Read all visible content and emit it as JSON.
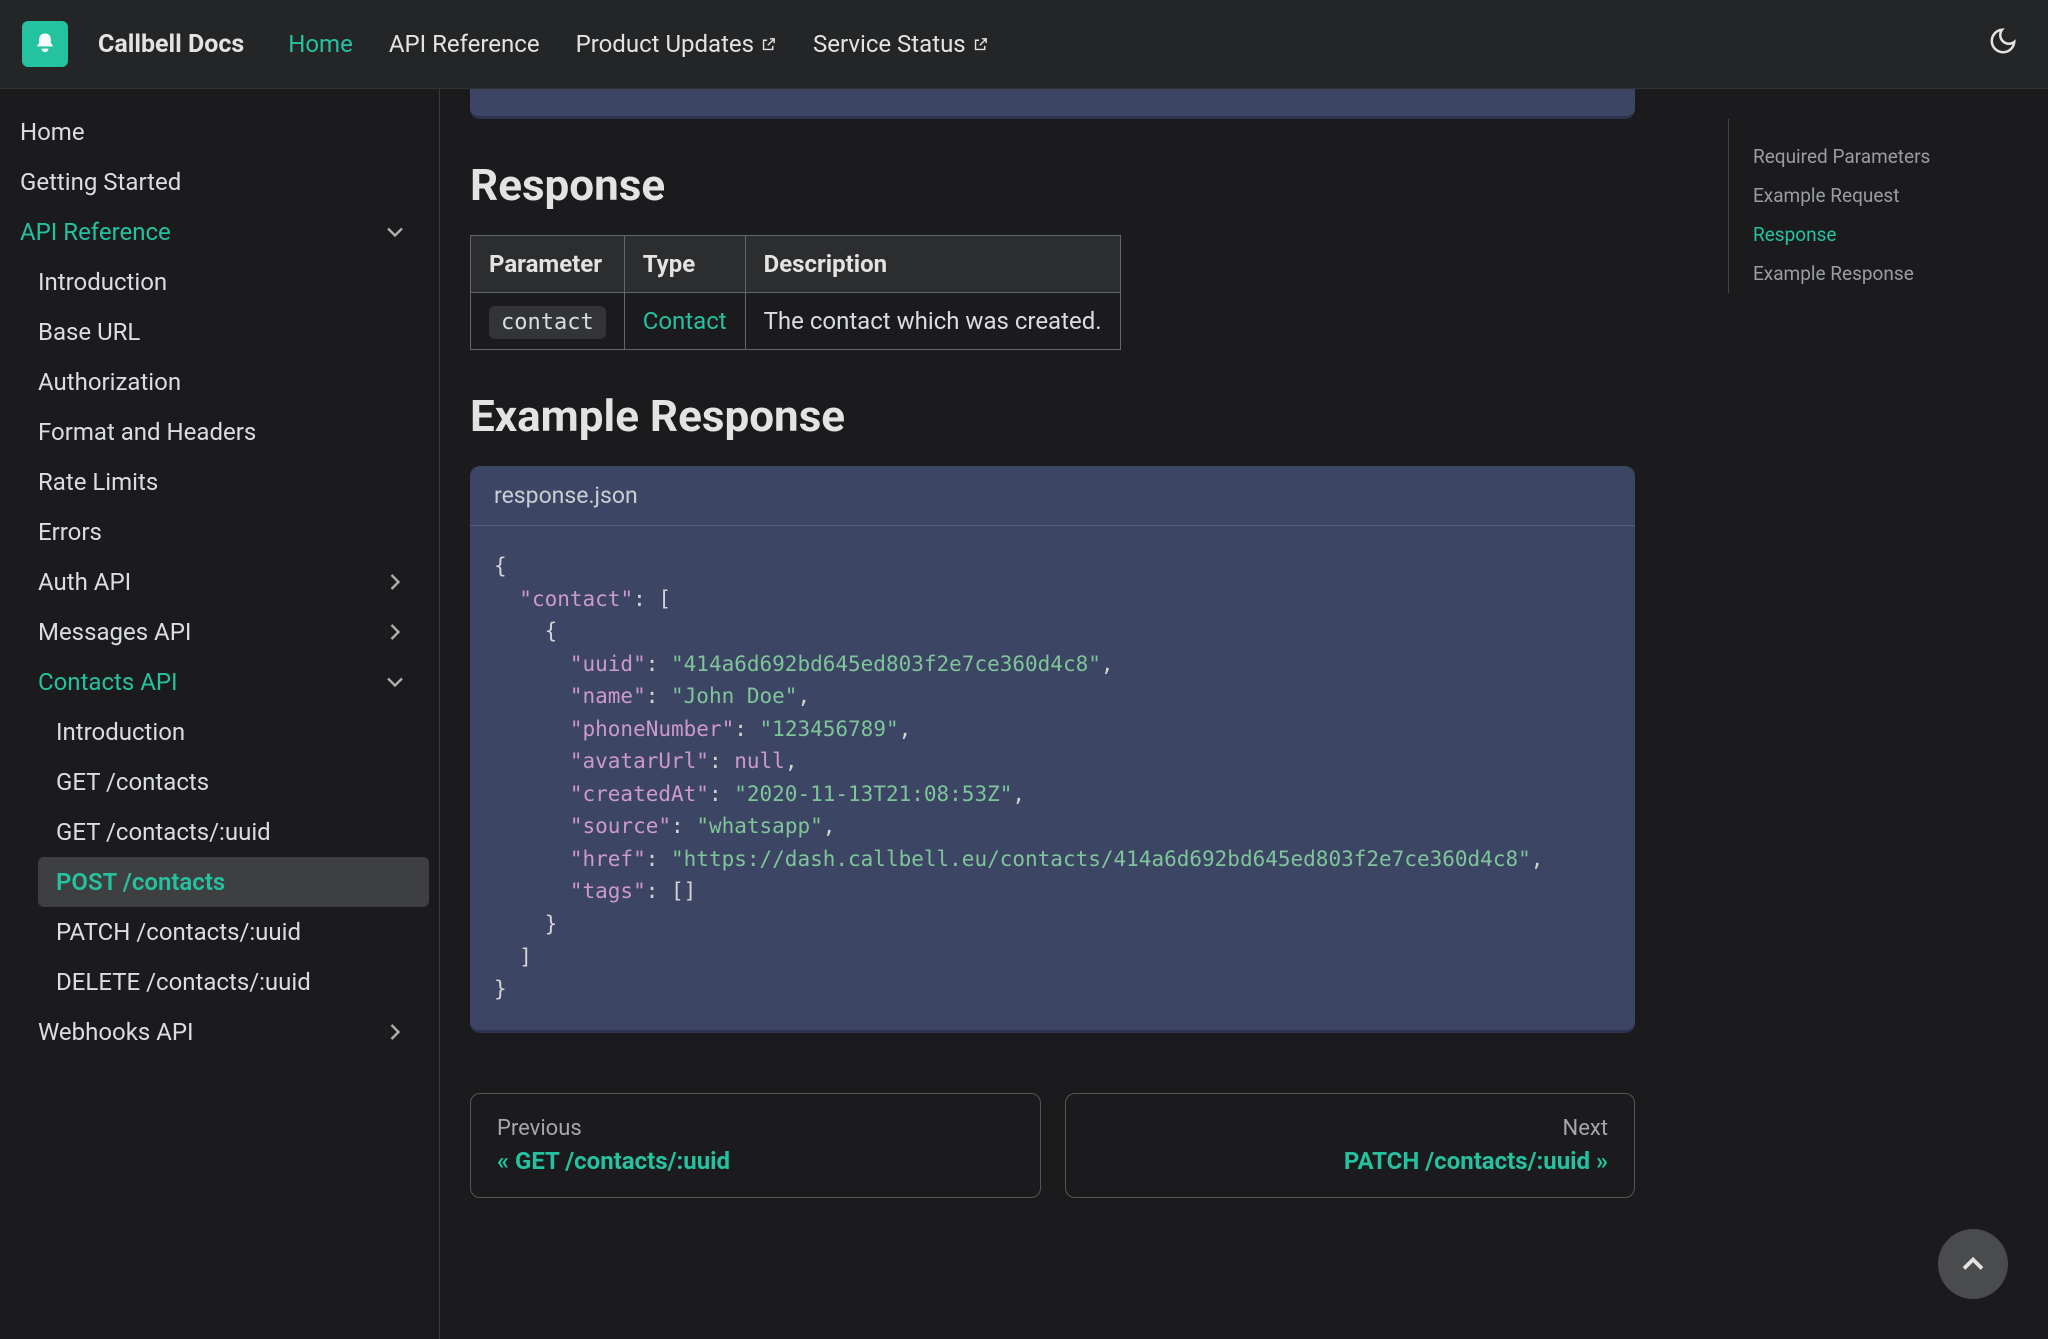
{
  "brand": "Callbell Docs",
  "nav": {
    "home": "Home",
    "api_ref": "API Reference",
    "product_updates": "Product Updates",
    "service_status": "Service Status"
  },
  "sidebar": {
    "home": "Home",
    "getting_started": "Getting Started",
    "api_reference": "API Reference",
    "introduction": "Introduction",
    "base_url": "Base URL",
    "authorization": "Authorization",
    "format_headers": "Format and Headers",
    "rate_limits": "Rate Limits",
    "errors": "Errors",
    "auth_api": "Auth API",
    "messages_api": "Messages API",
    "contacts_api": "Contacts API",
    "contacts_intro": "Introduction",
    "get_contacts": "GET /contacts",
    "get_contacts_uuid": "GET /contacts/:uuid",
    "post_contacts": "POST /contacts",
    "patch_contacts_uuid": "PATCH /contacts/:uuid",
    "delete_contacts_uuid": "DELETE /contacts/:uuid",
    "webhooks_api": "Webhooks API"
  },
  "headings": {
    "response": "Response",
    "example_response": "Example Response"
  },
  "table": {
    "headers": {
      "parameter": "Parameter",
      "type": "Type",
      "description": "Description"
    },
    "row": {
      "parameter": "contact",
      "type": "Contact",
      "description": "The contact which was created."
    }
  },
  "code_file": "response.json",
  "code": {
    "uuid": "\"414a6d692bd645ed803f2e7ce360d4c8\"",
    "name": "\"John Doe\"",
    "phoneNumber": "\"123456789\"",
    "avatarUrl": "null",
    "createdAt": "\"2020-11-13T21:08:53Z\"",
    "source": "\"whatsapp\"",
    "href": "\"https://dash.callbell.eu/contacts/414a6d692bd645ed803f2e7ce360d4c8\""
  },
  "pagenav": {
    "prev_label": "Previous",
    "prev_title": "« GET /contacts/:uuid",
    "next_label": "Next",
    "next_title": "PATCH /contacts/:uuid »"
  },
  "toc": {
    "required_params": "Required Parameters",
    "example_request": "Example Request",
    "response": "Response",
    "example_response": "Example Response"
  }
}
